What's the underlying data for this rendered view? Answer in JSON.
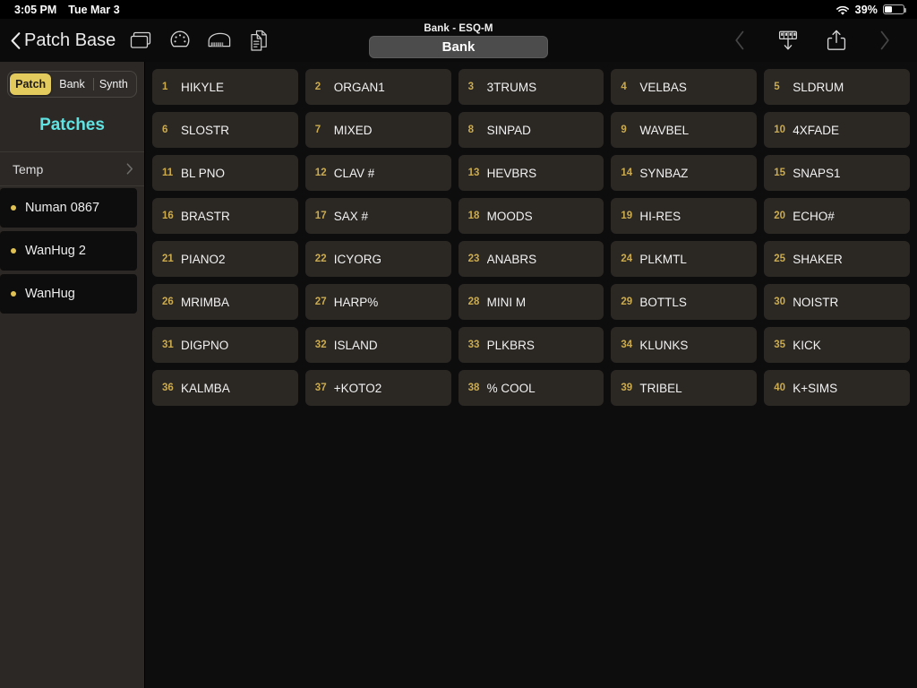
{
  "status_bar": {
    "time": "3:05 PM",
    "date": "Tue Mar 3",
    "wifi_icon": "wifi-icon",
    "battery_percent": "39%",
    "battery_icon": "battery-icon"
  },
  "nav": {
    "back_label": "Patch Base",
    "back_icon": "chevron-left-icon",
    "title": "Bank - ESQ-M",
    "segment_label": "Bank",
    "left_icons": [
      {
        "name": "windows-icon",
        "label": "Windows"
      },
      {
        "name": "midi-connector-icon",
        "label": "MIDI"
      },
      {
        "name": "piano-icon",
        "label": "Keyboard"
      },
      {
        "name": "duplicate-document-icon",
        "label": "Duplicate"
      }
    ],
    "right_icons": [
      {
        "name": "chevron-left-nav-icon",
        "label": "Previous",
        "dim": true
      },
      {
        "name": "send-to-synth-icon",
        "label": "Send to Synth",
        "dim": false
      },
      {
        "name": "share-icon",
        "label": "Share",
        "dim": false
      },
      {
        "name": "chevron-right-nav-icon",
        "label": "Next",
        "dim": true
      }
    ]
  },
  "sidebar": {
    "segments": [
      {
        "label": "Patch",
        "active": true
      },
      {
        "label": "Bank",
        "active": false
      },
      {
        "label": "Synth",
        "active": false
      }
    ],
    "heading": "Patches",
    "section": {
      "label": "Temp",
      "chevron": "chevron-right-icon"
    },
    "items": [
      {
        "label": "Numan 0867"
      },
      {
        "label": "WanHug 2"
      },
      {
        "label": "WanHug"
      }
    ]
  },
  "colors": {
    "accent_gold": "#e4cb5e",
    "accent_cyan": "#5fe3e3",
    "cell_bg": "#2b2824",
    "sidebar_bg": "#2b2825",
    "main_bg": "#0d0d0d",
    "number_gold": "#cbab4e"
  },
  "patches": [
    {
      "num": "1",
      "name": "HIKYLE"
    },
    {
      "num": "2",
      "name": "ORGAN1"
    },
    {
      "num": "3",
      "name": "3TRUMS"
    },
    {
      "num": "4",
      "name": "VELBAS"
    },
    {
      "num": "5",
      "name": "SLDRUM"
    },
    {
      "num": "6",
      "name": "SLOSTR"
    },
    {
      "num": "7",
      "name": "MIXED"
    },
    {
      "num": "8",
      "name": "SINPAD"
    },
    {
      "num": "9",
      "name": "WAVBEL"
    },
    {
      "num": "10",
      "name": "4XFADE"
    },
    {
      "num": "11",
      "name": "BL PNO"
    },
    {
      "num": "12",
      "name": "CLAV #"
    },
    {
      "num": "13",
      "name": "HEVBRS"
    },
    {
      "num": "14",
      "name": "SYNBAZ"
    },
    {
      "num": "15",
      "name": "SNAPS1"
    },
    {
      "num": "16",
      "name": "BRASTR"
    },
    {
      "num": "17",
      "name": "SAX #"
    },
    {
      "num": "18",
      "name": "MOODS"
    },
    {
      "num": "19",
      "name": "HI-RES"
    },
    {
      "num": "20",
      "name": "ECHO#"
    },
    {
      "num": "21",
      "name": "PIANO2"
    },
    {
      "num": "22",
      "name": "ICYORG"
    },
    {
      "num": "23",
      "name": "ANABRS"
    },
    {
      "num": "24",
      "name": "PLKMTL"
    },
    {
      "num": "25",
      "name": "SHAKER"
    },
    {
      "num": "26",
      "name": "MRIMBA"
    },
    {
      "num": "27",
      "name": "HARP%"
    },
    {
      "num": "28",
      "name": "MINI M"
    },
    {
      "num": "29",
      "name": "BOTTLS"
    },
    {
      "num": "30",
      "name": "NOISTR"
    },
    {
      "num": "31",
      "name": "DIGPNO"
    },
    {
      "num": "32",
      "name": "ISLAND"
    },
    {
      "num": "33",
      "name": "PLKBRS"
    },
    {
      "num": "34",
      "name": "KLUNKS"
    },
    {
      "num": "35",
      "name": "KICK"
    },
    {
      "num": "36",
      "name": "KALMBA"
    },
    {
      "num": "37",
      "name": "+KOTO2"
    },
    {
      "num": "38",
      "name": "% COOL"
    },
    {
      "num": "39",
      "name": "TRIBEL"
    },
    {
      "num": "40",
      "name": "K+SIMS"
    }
  ]
}
